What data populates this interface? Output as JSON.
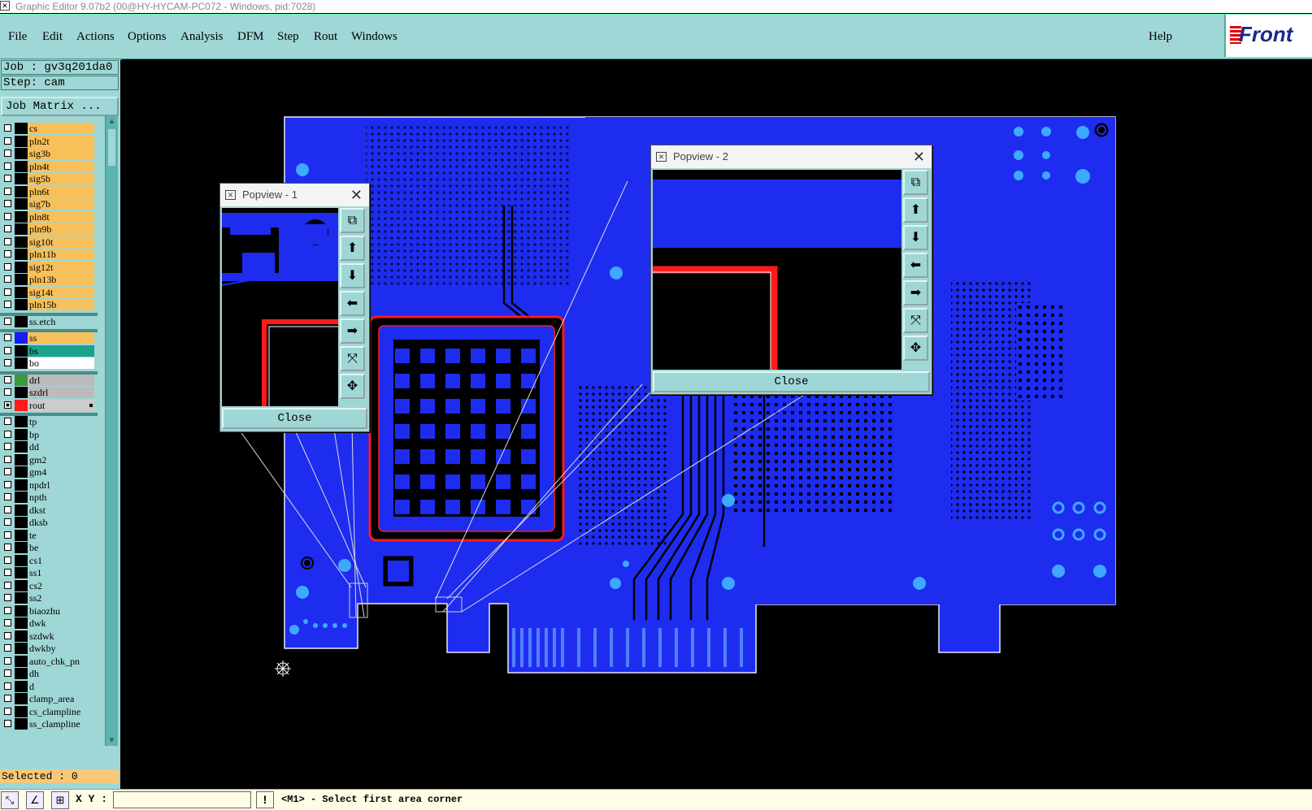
{
  "window": {
    "title": "Graphic Editor 9.07b2 (00@HY-HYCAM-PC072 - Windows, pid:7028)"
  },
  "menu": {
    "items": [
      "File",
      "Edit",
      "Actions",
      "Options",
      "Analysis",
      "DFM",
      "Step",
      "Rout",
      "Windows"
    ],
    "help": "Help",
    "logo": "Front"
  },
  "job": {
    "job_label": "Job : gv3q201da0",
    "step_label": "Step: cam",
    "matrix_button": "Job Matrix ..."
  },
  "layers": [
    {
      "name": "cs",
      "color": "#f8c05a",
      "swatch": "#000"
    },
    {
      "name": "pln2t",
      "color": "#f8c05a",
      "swatch": "#000"
    },
    {
      "name": "sig3b",
      "color": "#f8c05a",
      "swatch": "#000"
    },
    {
      "name": "pln4t",
      "color": "#f8c05a",
      "swatch": "#000"
    },
    {
      "name": "sig5b",
      "color": "#f8c05a",
      "swatch": "#000"
    },
    {
      "name": "pln6t",
      "color": "#f8c05a",
      "swatch": "#000"
    },
    {
      "name": "sig7b",
      "color": "#f8c05a",
      "swatch": "#000"
    },
    {
      "name": "pln8t",
      "color": "#f8c05a",
      "swatch": "#000"
    },
    {
      "name": "pln9b",
      "color": "#f8c05a",
      "swatch": "#000"
    },
    {
      "name": "sig10t",
      "color": "#f8c05a",
      "swatch": "#000"
    },
    {
      "name": "pln11b",
      "color": "#f8c05a",
      "swatch": "#000"
    },
    {
      "name": "sig12t",
      "color": "#f8c05a",
      "swatch": "#000"
    },
    {
      "name": "pln13b",
      "color": "#f8c05a",
      "swatch": "#000"
    },
    {
      "name": "sig14t",
      "color": "#f8c05a",
      "swatch": "#000"
    },
    {
      "name": "pln15b",
      "color": "#f8c05a",
      "swatch": "#000"
    },
    {
      "name": "ss.etch",
      "color": "#9fd7d6",
      "swatch": "#000",
      "sep_before": true
    },
    {
      "name": "ss",
      "color": "#f8c05a",
      "swatch": "#1a1aff",
      "sep_before": true
    },
    {
      "name": "bs",
      "color": "#1aa38a",
      "swatch": "#000"
    },
    {
      "name": "bo",
      "color": "#ffffff",
      "swatch": "#000"
    },
    {
      "name": "drl",
      "color": "#bbbbbb",
      "swatch": "#3a9a3a",
      "sep_before": true
    },
    {
      "name": "szdrl",
      "color": "#bbbbbb",
      "swatch": "#000"
    },
    {
      "name": "rout",
      "color": "#cccccc",
      "swatch": "#ff1a1a",
      "checked": true,
      "marker": true
    },
    {
      "name": "tp",
      "color": "#9fd7d6",
      "swatch": "#000",
      "sep_before": true
    },
    {
      "name": "bp",
      "color": "#9fd7d6",
      "swatch": "#000"
    },
    {
      "name": "dd",
      "color": "#9fd7d6",
      "swatch": "#000"
    },
    {
      "name": "gm2",
      "color": "#9fd7d6",
      "swatch": "#000"
    },
    {
      "name": "gm4",
      "color": "#9fd7d6",
      "swatch": "#000"
    },
    {
      "name": "npdrl",
      "color": "#9fd7d6",
      "swatch": "#000"
    },
    {
      "name": "npth",
      "color": "#9fd7d6",
      "swatch": "#000"
    },
    {
      "name": "dkst",
      "color": "#9fd7d6",
      "swatch": "#000"
    },
    {
      "name": "dksb",
      "color": "#9fd7d6",
      "swatch": "#000"
    },
    {
      "name": "te",
      "color": "#9fd7d6",
      "swatch": "#000"
    },
    {
      "name": "be",
      "color": "#9fd7d6",
      "swatch": "#000"
    },
    {
      "name": "cs1",
      "color": "#9fd7d6",
      "swatch": "#000"
    },
    {
      "name": "ss1",
      "color": "#9fd7d6",
      "swatch": "#000"
    },
    {
      "name": "cs2",
      "color": "#9fd7d6",
      "swatch": "#000"
    },
    {
      "name": "ss2",
      "color": "#9fd7d6",
      "swatch": "#000"
    },
    {
      "name": "biaozhu",
      "color": "#9fd7d6",
      "swatch": "#000"
    },
    {
      "name": "dwk",
      "color": "#9fd7d6",
      "swatch": "#000"
    },
    {
      "name": "szdwk",
      "color": "#9fd7d6",
      "swatch": "#000"
    },
    {
      "name": "dwkby",
      "color": "#9fd7d6",
      "swatch": "#000"
    },
    {
      "name": "auto_chk_pn",
      "color": "#9fd7d6",
      "swatch": "#000"
    },
    {
      "name": "dh",
      "color": "#9fd7d6",
      "swatch": "#000"
    },
    {
      "name": "d",
      "color": "#9fd7d6",
      "swatch": "#000"
    },
    {
      "name": "clamp_area",
      "color": "#9fd7d6",
      "swatch": "#000"
    },
    {
      "name": "cs_clampline",
      "color": "#9fd7d6",
      "swatch": "#000"
    },
    {
      "name": "ss_clampline",
      "color": "#9fd7d6",
      "swatch": "#000"
    }
  ],
  "status": {
    "selected": "Selected : 0",
    "xy_label": "X Y :",
    "xy_value": "",
    "message": "<M1> - Select first area corner"
  },
  "popview1": {
    "title": "Popview - 1",
    "close": "Close"
  },
  "popview2": {
    "title": "Popview - 2",
    "close": "Close"
  },
  "colors": {
    "board": "#1e2cf0",
    "rout": "#ff1a1a",
    "panel": "#9fd7d6",
    "accent_orange": "#f8c05a"
  }
}
